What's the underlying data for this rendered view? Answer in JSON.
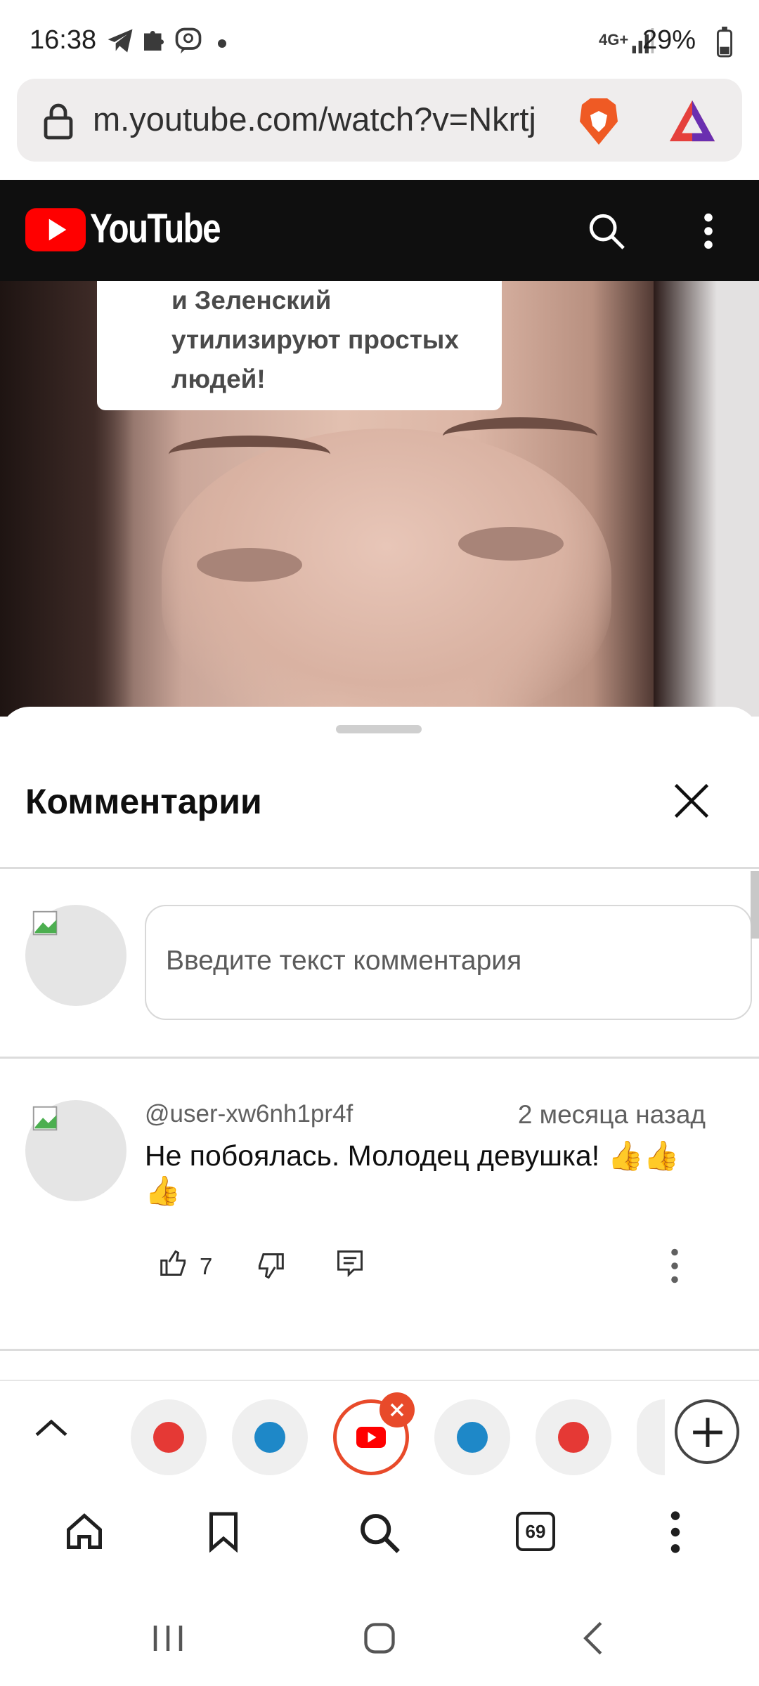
{
  "status_bar": {
    "time": "16:38",
    "network": "4G+",
    "battery": "29%"
  },
  "browser": {
    "url": "m.youtube.com/watch?v=Nkrtj"
  },
  "youtube": {
    "wordmark": "YouTube",
    "brand_color": "#ff0000"
  },
  "video": {
    "caption": "и Зеленский\nутилизируют простых\nлюдей!"
  },
  "comments": {
    "title": "Комментарии",
    "input_placeholder": "Введите текст комментария",
    "items": [
      {
        "author": "@user-xw6nh1pr4f",
        "time": "2 месяца назад",
        "text": "Не побоялась. Молодец девушка! 👍👍👍",
        "likes": "7"
      }
    ]
  },
  "tabs": {
    "tab_count": "69",
    "accent_color": "#e53935"
  }
}
